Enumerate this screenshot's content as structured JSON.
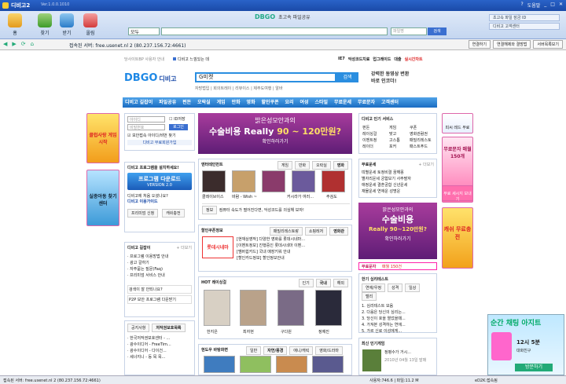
{
  "window": {
    "title": "디비고2",
    "version": "Ver.1.0.0.1010",
    "controls": [
      "?",
      "도움말",
      "_",
      "□",
      "✕"
    ]
  },
  "toolbar": {
    "buttons": [
      "홈",
      "찾기",
      "받기",
      "올림"
    ],
    "logo_a": "DB",
    "logo_b": "GO",
    "slogan": "초고속 파일공유",
    "search_category": "모두",
    "search_placeholder": "파일명",
    "search_button": "검색",
    "right_links": [
      "초고속 파일 잠금 ID",
      "디비고 고객센터"
    ]
  },
  "addressbar": {
    "nav_icons": [
      "back-icon",
      "forward-icon",
      "refresh-icon",
      "home-icon"
    ],
    "connected": "접속된 서버: free.usenet.nl 2 (80.237.156.72:4661)",
    "buttons": [
      "연결하기",
      "연결해제와 결방법",
      "서버목록보기"
    ]
  },
  "page": {
    "top_links": {
      "left": "당사이트BP 사용자 안내",
      "notice": "디비고 느낌있는 데",
      "right": [
        "IE7",
        "악성코드치료",
        "업그레이드",
        "대출",
        "실시간차트"
      ]
    },
    "logo_a": "DBGO",
    "logo_b": "디비고",
    "main_search_value": "G미켓",
    "main_search_button": "검색",
    "sub_links": "자방법입 | 회의트레이 | 리뷰이스 | 제주도여행 | 알바",
    "promo": "강력한 동영상 변환\n바로 인코더!",
    "nav": [
      "디비고 길잡이",
      "파일공유",
      "펀돈",
      "오락실",
      "게임",
      "만화",
      "영화",
      "할인쿠폰",
      "요리",
      "여성",
      "스타일",
      "무료운세",
      "무료문자",
      "고객센터"
    ],
    "login": {
      "id_placeholder": "아이디",
      "pw_placeholder": "비밀번호",
      "save_id": "ID저장",
      "login_button": "로그인",
      "secure": "보안접속",
      "join": "아이디/비번 찾기",
      "signup": "디비고 무료회원가입"
    },
    "install": {
      "title": "디비고 프로그램을 설치하세요!",
      "download": "프로그램 다운로드",
      "download_ver": "VERSION 2.0",
      "guide1": "디비고에 처음 오셨나요?",
      "guide2": "디비고 이용가이드",
      "premium": "프리미엄 신청",
      "event": "캐쉬충전"
    },
    "guide_box": {
      "title": "디비고 길잡이",
      "more": "+ 더보기",
      "items": [
        "· 프로그램 이용방법 안내",
        "· 광고 갈하기",
        "· 자주묻는 질문(Faq)",
        "· 프리미엄 서비스 안내"
      ],
      "q1": "검색이 잘 안되나요?",
      "q2": "P2P 보안 프로그램 다운받기"
    },
    "notice_box": {
      "tabs": [
        "공지사항",
        "저작권보호목록"
      ],
      "items": [
        "· 한국저작권보호센터 - ...",
        "· 광수이디어 - FreeTim...",
        "· 광수이디어 - 다이건...",
        "· 세너지니 - 등 목 목..."
      ]
    },
    "center_banner": {
      "title": "밝은성모안과의",
      "line1": "수술비용 Really",
      "range": "90 ~ 120만원?",
      "cta": "확인하러가기"
    },
    "entertainment": {
      "title": "엔터테인먼트",
      "tabs": [
        "게임",
        "만화",
        "오락실",
        "영화"
      ],
      "captions": [
        "클레이브이스",
        "바람 - Wish ~",
        "커시라가 여러...",
        "",
        "주검도"
      ],
      "footer": "컴퓨터 속도가 떨어진다면, 악성코드를 의심해 보자!",
      "footer_tag": "정보"
    },
    "coupon": {
      "title": "할인쿠폰정보",
      "tabs": [
        "패밀리레스토랑",
        "쇼핑레저",
        "영화관"
      ],
      "cinema": "롯데시네마",
      "items": [
        "[현재상영작] 다양한 영화를 롯데시네마...",
        "[이벤트정보] 진행중인 롯데시네마 이벤...",
        "[멤버쉽카드] 국내 매장키워 안내",
        "[할인카드정보] 할인정보안내"
      ]
    },
    "hot": {
      "title": "HOT 레이싱걸",
      "tabs": [
        "인기",
        "국내",
        "해외"
      ],
      "captions": [
        "한지은",
        "최자현",
        "구다원",
        "정예진"
      ]
    },
    "hyundai": {
      "title": "현도우 바탕화면",
      "tabs": [
        "일반",
        "자연/풍경",
        "애니/캐릭",
        "영화/드라마"
      ]
    },
    "popular": {
      "title": "디비고 인기 서비스",
      "more": "+ 더보기",
      "col1": [
        "펀돈",
        "레이싱걸",
        "이벤트정",
        "레이더",
        "오늘의날씨"
      ],
      "col2": [
        "게임",
        "맞고",
        "고스톱",
        "포커",
        "체스"
      ],
      "col3": [
        "쿠폰",
        "영화관람권",
        "패밀리레스토",
        "패스트푸드",
        "소셜커머스"
      ]
    },
    "fortune": {
      "title": "무료운세",
      "more": "+ 더보기",
      "rows": [
        "띠별운세 토정비결 꿈해몽",
        "별자리운세 궁합보기 사주팔자",
        "애정운세 결혼궁합 신년운세",
        "재물운세 연애운 성명운"
      ]
    },
    "right_banner": {
      "title": "밝은성모안과의",
      "line1": "수술비용",
      "range": "Really 90~120만원?",
      "cta": "확인하러가기"
    },
    "free_sms": {
      "label": "무료문자",
      "price": "매월 150건"
    },
    "test": {
      "title": "한기 심리테스트",
      "tabs": [
        "연애/우정",
        "성격",
        "일상",
        "텔리"
      ],
      "items": [
        "1. 심리테스트 모음",
        "2. 다음은 당신의 심리는...",
        "3. 당신이 호을 열었을때...",
        "4. 가져본 성격하는 연애...",
        "5. 가르 신로 이성에게..."
      ]
    },
    "new_games": {
      "title": "최신 인기게임",
      "text": "정평수가 거시...",
      "date": "2010년 04월 13일 발매"
    },
    "left_ads": [
      "클럽사랑 게임시작",
      "실종아동 찾기센터"
    ],
    "right_ads": [
      "피씨 레드 무료",
      "무료문자 매월 150개",
      "무료 세시지 보내기",
      "캐쉬 무료충전"
    ],
    "popup": {
      "title": "순간 채팅 아지트",
      "info": "12시 5분",
      "button": "방문하기",
      "sub": "대화친구"
    }
  },
  "status": {
    "left": "접속된 서버: free.usenet.nl 2 (80.237.156.72:4661)",
    "middle": "사용자:746.6 | 파일:11.2 M",
    "right": "eD2K:접속됨"
  }
}
